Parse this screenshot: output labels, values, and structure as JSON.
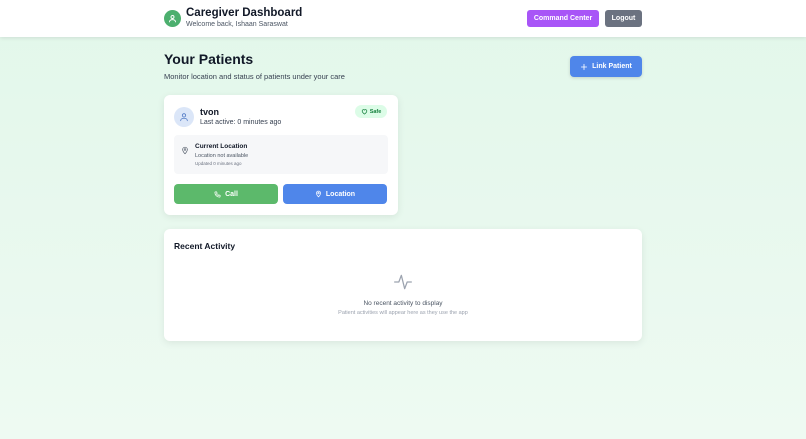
{
  "header": {
    "title": "Caregiver Dashboard",
    "welcome": "Welcome back, Ishaan Saraswat",
    "command_center_label": "Command Center",
    "logout_label": "Logout",
    "brand_icon": "user-icon"
  },
  "page": {
    "title": "Your Patients",
    "subtitle": "Monitor location and status of patients under your care",
    "link_patient_label": "Link Patient"
  },
  "patient": {
    "name": "tvon",
    "last_active": "Last active: 0 minutes ago",
    "status_badge": "Safe",
    "location": {
      "title": "Current Location",
      "status": "Location not available",
      "updated": "Updated 0 minutes ago"
    },
    "call_label": "Call",
    "location_label": "Location"
  },
  "activity": {
    "title": "Recent Activity",
    "empty_title": "No recent activity to display",
    "empty_subtitle": "Patient activities will appear here as they use the app"
  },
  "colors": {
    "brand_green": "#4caf6e",
    "command_purple": "#a855f7",
    "logout_gray": "#6b7280",
    "primary_blue": "#4f86ea",
    "call_green": "#5cb96b",
    "safe_bg": "#dcfce7",
    "safe_text": "#15803d"
  }
}
